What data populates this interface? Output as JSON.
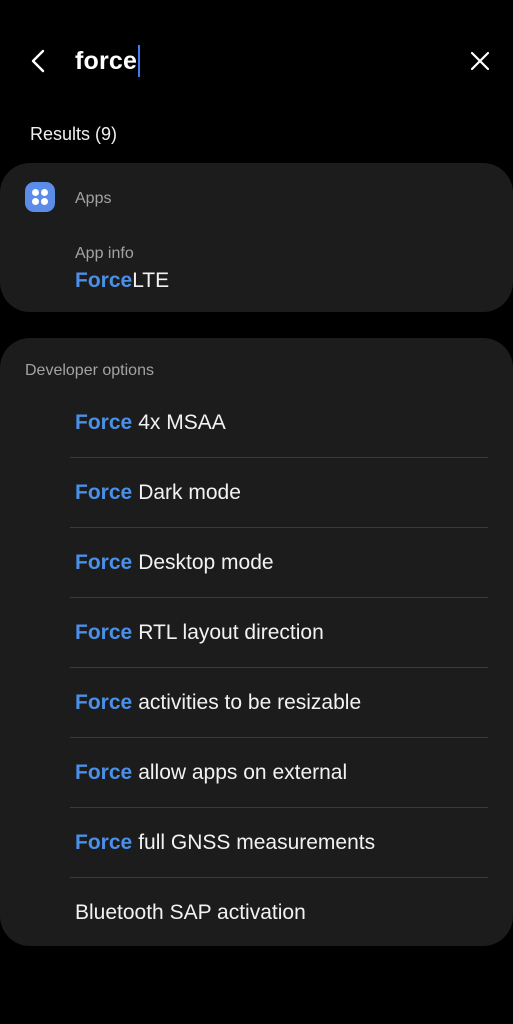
{
  "search": {
    "query": "force"
  },
  "results": {
    "label": "Results (9)"
  },
  "apps_section": {
    "header": "Apps",
    "sub_label": "App info",
    "result_highlight": "Force",
    "result_rest": "LTE"
  },
  "developer_section": {
    "header": "Developer options",
    "items": [
      {
        "highlight": "Force",
        "rest": "4x MSAA"
      },
      {
        "highlight": "Force",
        "rest": "Dark mode"
      },
      {
        "highlight": "Force",
        "rest": "Desktop mode"
      },
      {
        "highlight": "Force",
        "rest": "RTL layout direction"
      },
      {
        "highlight": "Force",
        "rest": "activities to be resizable"
      },
      {
        "highlight": "Force",
        "rest": "allow apps on external"
      },
      {
        "highlight": "Force",
        "rest": "full GNSS measurements"
      },
      {
        "highlight": "",
        "rest": "Bluetooth SAP activation"
      }
    ]
  },
  "colors": {
    "background": "#000000",
    "card": "#1c1c1c",
    "highlight": "#4a8fe8",
    "caret": "#3e7ef2",
    "apps_icon": "#5b8de8"
  },
  "icons": {
    "back": "back-arrow-icon",
    "close": "close-icon",
    "apps": "apps-grid-icon"
  }
}
